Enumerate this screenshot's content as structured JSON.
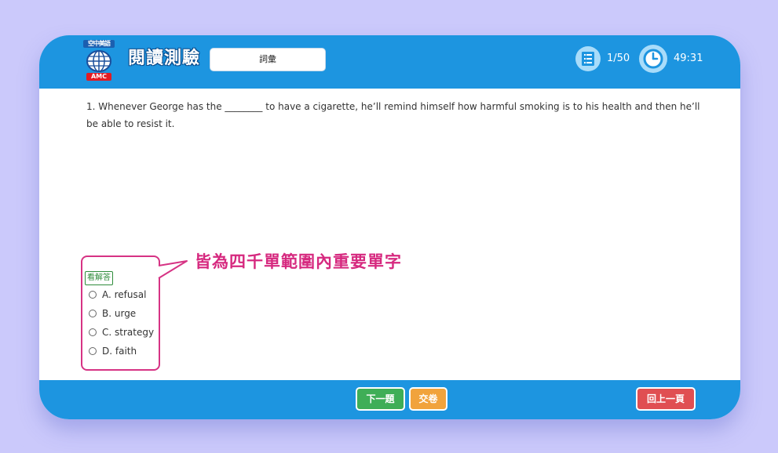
{
  "header": {
    "logo_top_text": "空中美語",
    "logo_bottom_text": "AMC",
    "title": "閱讀測驗",
    "category": "詞彙",
    "progress": "1/50",
    "timer": "49:31",
    "list_icon": "list-icon",
    "clock_icon": "clock-icon"
  },
  "question": {
    "text": "1. Whenever George has the ________ to have a cigarette, he’ll remind himself how harmful smoking is to his health and then he’ll be able to resist it."
  },
  "answers": {
    "show_answer_label": "看解答",
    "options": [
      {
        "label": "A. refusal"
      },
      {
        "label": "B. urge"
      },
      {
        "label": "C. strategy"
      },
      {
        "label": "D. faith"
      }
    ]
  },
  "callout": {
    "text": "皆為四千單範圍內重要單字",
    "color": "#d6297f"
  },
  "footer": {
    "next_label": "下一題",
    "submit_label": "交卷",
    "back_label": "回上一頁"
  },
  "colors": {
    "header": "#1d95e0",
    "background": "#cbc9fb",
    "next": "#3fae57",
    "submit": "#f1a33c",
    "back": "#e04f52"
  }
}
